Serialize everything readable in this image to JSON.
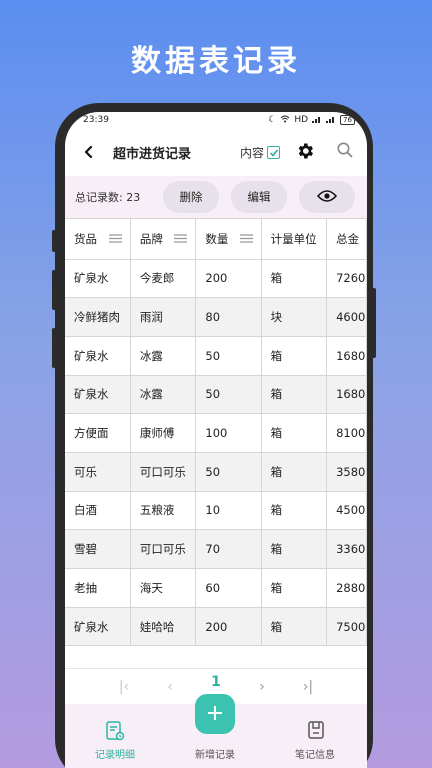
{
  "promo": {
    "title": "数据表记录"
  },
  "status": {
    "time": "23:39",
    "signal": "HD",
    "battery": "76"
  },
  "appbar": {
    "title": "超市进货记录",
    "content_label": "内容"
  },
  "actions": {
    "total_label": "总记录数: 23",
    "delete_label": "删除",
    "edit_label": "编辑"
  },
  "table": {
    "headers": [
      "货品",
      "品牌",
      "数量",
      "计量单位",
      "总金"
    ],
    "rows": [
      [
        "矿泉水",
        "今麦郎",
        "200",
        "箱",
        "7260"
      ],
      [
        "冷鲜猪肉",
        "雨润",
        "80",
        "块",
        "4600"
      ],
      [
        "矿泉水",
        "冰露",
        "50",
        "箱",
        "1680"
      ],
      [
        "矿泉水",
        "冰露",
        "50",
        "箱",
        "1680"
      ],
      [
        "方便面",
        "康师傅",
        "100",
        "箱",
        "8100"
      ],
      [
        "可乐",
        "可口可乐",
        "50",
        "箱",
        "3580"
      ],
      [
        "白酒",
        "五粮液",
        "10",
        "箱",
        "4500"
      ],
      [
        "雪碧",
        "可口可乐",
        "70",
        "箱",
        "3360"
      ],
      [
        "老抽",
        "海天",
        "60",
        "箱",
        "2880"
      ],
      [
        "矿泉水",
        "娃哈哈",
        "200",
        "箱",
        "7500"
      ]
    ]
  },
  "pagination": {
    "current": "1"
  },
  "nav": {
    "records": "记录明细",
    "add": "新增记录",
    "notes": "笔记信息"
  },
  "colors": {
    "accent": "#2bb5a0",
    "fab": "#3cc3b0"
  }
}
